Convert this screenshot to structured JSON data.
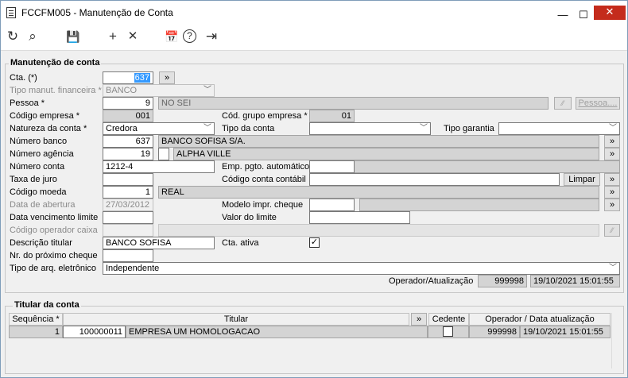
{
  "window": {
    "title": "FCCFM005 - Manutenção de Conta",
    "minimize": "—",
    "maximize": "☐",
    "close": "✕"
  },
  "toolbar": {
    "refresh": "↻",
    "search": "⌕",
    "save": "💾",
    "add": "+",
    "cancel": "✕",
    "calendar": "📅",
    "help": "?",
    "exit": "⇥"
  },
  "main": {
    "group_title": "Manutenção de conta",
    "cta_label": "Cta. (*)",
    "cta_value": "637",
    "cta_btn": "»",
    "tipo_manut_label": "Tipo manut. financeira *",
    "tipo_manut_value": "BANCO",
    "pessoa_label": "Pessoa *",
    "pessoa_code": "9",
    "pessoa_name": "NO SEI",
    "pessoa_btn": "Pessoa....",
    "pessoa_icon_btn": "⁄⁄",
    "cod_empresa_label": "Código empresa *",
    "cod_empresa_value": "001",
    "cod_grupo_label": "Cód. grupo empresa *",
    "cod_grupo_value": "01",
    "natureza_label": "Natureza da conta *",
    "natureza_value": "Credora",
    "tipo_conta_label": "Tipo da conta",
    "tipo_conta_value": "",
    "tipo_garantia_label": "Tipo garantia",
    "tipo_garantia_value": "",
    "num_banco_label": "Número banco",
    "num_banco_value": "637",
    "num_banco_name": "BANCO SOFISA S/A.",
    "num_agencia_label": "Número agência",
    "num_agencia_value": "19",
    "num_agencia_dv": "",
    "num_agencia_name": "ALPHA VILLE",
    "num_conta_label": "Número conta",
    "num_conta_value": "1212-4",
    "emp_pgto_label": "Emp. pgto. automático",
    "emp_pgto_value": "",
    "taxa_juro_label": "Taxa de juro",
    "taxa_juro_value": "",
    "cod_conta_contabil_label": "Código conta contábil",
    "cod_conta_contabil_value": "",
    "limpar_btn": "Limpar",
    "cod_moeda_label": "Código moeda",
    "cod_moeda_value": "1",
    "cod_moeda_name": "REAL",
    "data_abertura_label": "Data de abertura",
    "data_abertura_value": "27/03/2012",
    "modelo_cheque_label": "Modelo impr. cheque",
    "modelo_cheque_value": "",
    "modelo_cheque_name": "",
    "data_venc_label": "Data vencimento limite",
    "data_venc_value": "",
    "valor_limite_label": "Valor do limite",
    "valor_limite_value": "",
    "cod_operador_label": "Código operador caixa",
    "cod_operador_value": "",
    "cod_operador_name": "",
    "desc_titular_label": "Descrição titular",
    "desc_titular_value": "BANCO SOFISA",
    "cta_ativa_label": "Cta. ativa",
    "cta_ativa_check": "✓",
    "nr_cheque_label": "Nr. do próximo cheque",
    "nr_cheque_value": "",
    "tipo_arq_label": "Tipo de arq. eletrônico",
    "tipo_arq_value": "Independente",
    "operador_label": "Operador/Atualização",
    "operador_value": "999998",
    "operador_date": "19/10/2021 15:01:55",
    "more_btn": "»"
  },
  "titular": {
    "group_title": "Titular da conta",
    "headers": {
      "sequencia": "Sequência *",
      "titular": "Titular",
      "more": "»",
      "cedente": "Cedente",
      "operador": "Operador / Data atualização"
    },
    "rows": [
      {
        "sequencia": "1",
        "codigo": "100000011",
        "nome": "EMPRESA UM HOMOLOGACAO",
        "cedente": "",
        "operador": "999998",
        "data": "19/10/2021 15:01:55"
      }
    ]
  }
}
